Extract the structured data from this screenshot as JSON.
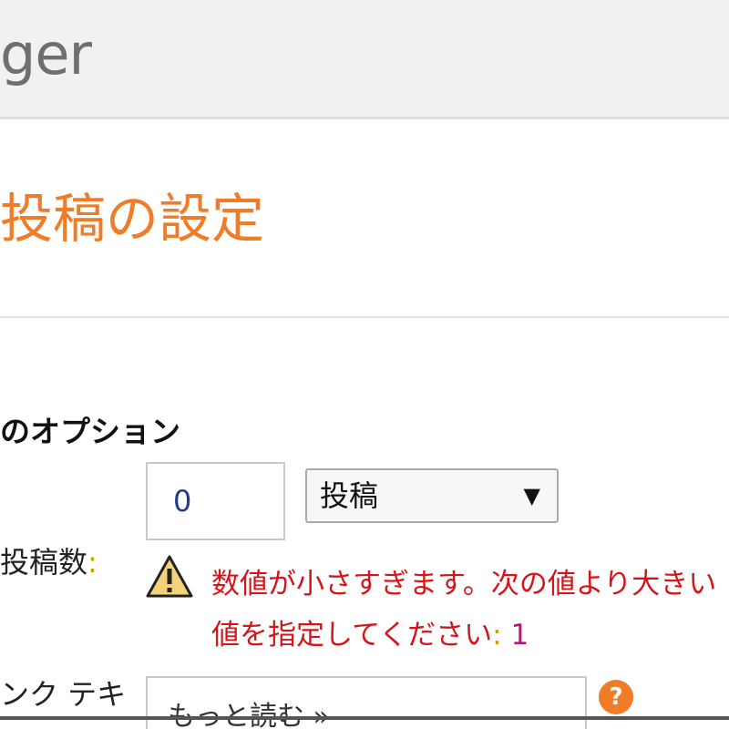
{
  "header": {
    "app_title": "ger"
  },
  "dialog": {
    "title": "投稿の設定"
  },
  "section": {
    "heading": "のオプション"
  },
  "posts_count": {
    "label": "投稿数",
    "colon": ":",
    "value": "0",
    "unit_select": {
      "selected": "投稿",
      "arrow": "▼"
    },
    "warning": {
      "icon": "warning-icon",
      "message": "数値が小さすぎます。次の値より大きい値を指定してください",
      "colon": ":",
      "min_value": "1"
    }
  },
  "link_text": {
    "label": "ンク テキ",
    "value": "もっと読む »",
    "help_icon": "?"
  },
  "colors": {
    "accent": "#f07c27",
    "error": "#d4151b",
    "header_bg": "#f1f1f1"
  }
}
